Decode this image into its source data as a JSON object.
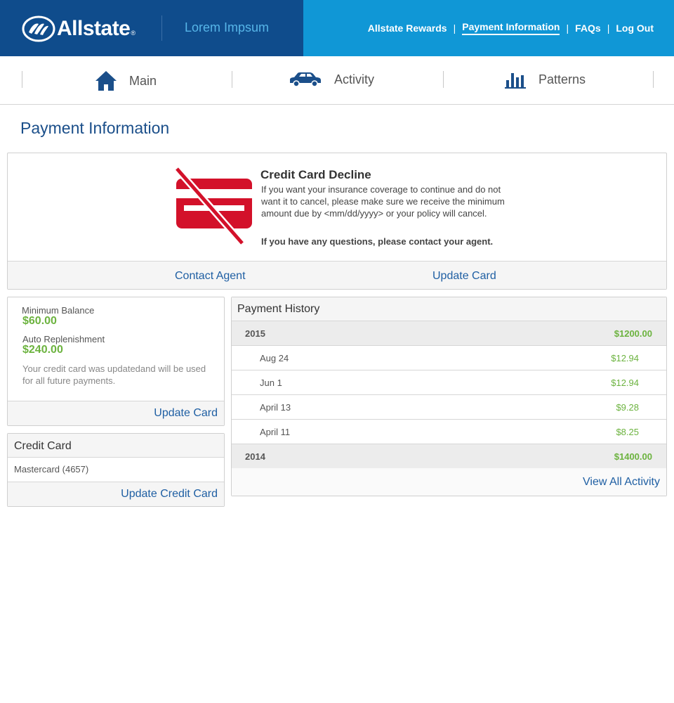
{
  "header": {
    "brand": "Allstate",
    "brand_mark": "®",
    "subtitle": "Lorem Impsum",
    "links": [
      {
        "label": "Allstate Rewards",
        "active": false
      },
      {
        "label": "Payment Information",
        "active": true
      },
      {
        "label": "FAQs",
        "active": false
      },
      {
        "label": "Log Out",
        "active": false
      }
    ],
    "separator": "|"
  },
  "nav": {
    "items": [
      {
        "label": "Main",
        "icon": "home-icon"
      },
      {
        "label": "Activity",
        "icon": "car-icon"
      },
      {
        "label": "Patterns",
        "icon": "bar-chart-icon"
      }
    ]
  },
  "page": {
    "title": "Payment Information"
  },
  "alert": {
    "icon": "credit-card-declined-icon",
    "title": "Credit Card Decline",
    "body": "If you want your insurance coverage to continue and do not want it to cancel, please make sure we receive the minimum amount due by <mm/dd/yyyy> or your policy will cancel.",
    "strong": "If you have any questions, please contact your agent.",
    "contact_label": "Contact Agent",
    "update_label": "Update Card"
  },
  "balance": {
    "min_label": "Minimum Balance",
    "min_value": "$60.00",
    "auto_label": "Auto Replenishment",
    "auto_value": "$240.00",
    "note": "Your credit card was updatedand will be used for all future payments.",
    "update_label": "Update Card"
  },
  "credit_card": {
    "title": "Credit Card",
    "card": "Mastercard (4657)",
    "update_label": "Update Credit Card"
  },
  "payment_history": {
    "title": "Payment History",
    "years": [
      {
        "year": "2015",
        "total": "$1200.00",
        "entries": [
          {
            "date": "Aug 24",
            "amount": "$12.94"
          },
          {
            "date": "Jun 1",
            "amount": "$12.94"
          },
          {
            "date": "April 13",
            "amount": "$9.28"
          },
          {
            "date": "April 11",
            "amount": "$8.25"
          }
        ]
      },
      {
        "year": "2014",
        "total": "$1400.00",
        "entries": []
      }
    ],
    "view_all_label": "View All Activity"
  },
  "colors": {
    "header_dark": "#0f4c8c",
    "header_light": "#1097d6",
    "link": "#1f5fa3",
    "positive": "#6cb33f",
    "alert_red": "#d3112a"
  }
}
